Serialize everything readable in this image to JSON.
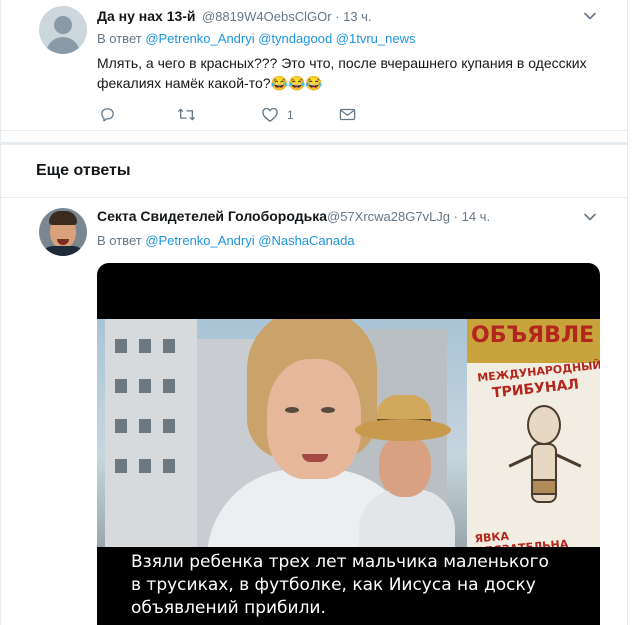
{
  "tweet1": {
    "name": "Да ну нах 13-й",
    "handle": "@8819W4OebsClGOr",
    "time": "· 13 ч.",
    "reply_prefix": "В ответ ",
    "mentions": [
      "@Petrenko_Andryi",
      "@tyndagood",
      "@1tvru_news"
    ],
    "text_line1": "Млять, а чего в красных??? Это что, после вчерашнего купания в одесских",
    "text_line2": "фекалиях намёк какой-то?😂😂😂",
    "actions": {
      "reply_icon": "reply-icon",
      "retweet_icon": "retweet-icon",
      "like_icon": "heart-icon",
      "like_count": "1",
      "dm_icon": "envelope-icon"
    }
  },
  "section": {
    "title": "Еще ответы"
  },
  "tweet2": {
    "name": "Секта Свидетелей Голобородька",
    "handle": "@57Xrcwa28G7vLJg",
    "time": "· 14 ч.",
    "reply_prefix": "В ответ ",
    "mentions": [
      "@Petrenko_Andryi",
      "@NashaCanada"
    ],
    "media": {
      "poster_title": "ОБЪЯВЛЕ",
      "poster_sub1": "МЕЖДУНАРОДНЫЙ",
      "poster_sub2": "ТРИБУНАЛ",
      "poster_foot": "ЯВКА ОБЯЗАТЕЛЬНА",
      "caption_line1": "Взяли ребенка трех лет мальчика маленького",
      "caption_line2": "в трусиках, в футболке, как Иисуса на доску",
      "caption_line3": "объявлений прибили."
    }
  },
  "colors": {
    "link": "#1b95e0",
    "muted": "#657786",
    "text": "#14171a",
    "separator": "#e6ecf0"
  }
}
